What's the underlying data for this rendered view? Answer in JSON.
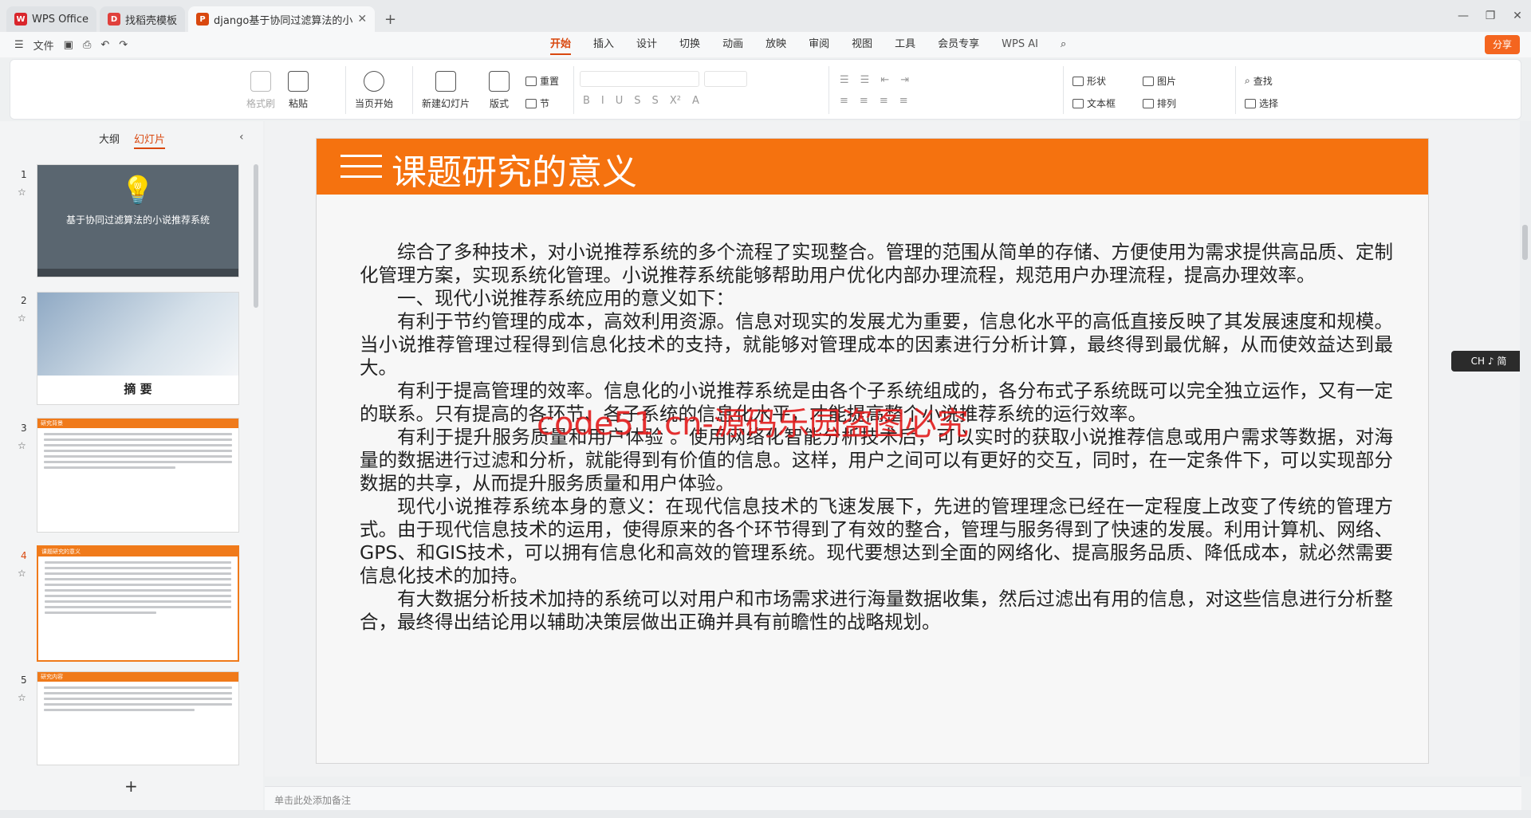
{
  "tabs": [
    {
      "label": "WPS Office",
      "icon": "wps-logo-icon",
      "color": "#d9262c"
    },
    {
      "label": "找稻壳模板",
      "icon": "docer-icon",
      "color": "#e0403c"
    },
    {
      "label": "django基于协同过滤算法的小",
      "icon": "ppt-icon",
      "color": "#d9480f"
    }
  ],
  "menu": {
    "file": "文件",
    "tabs": [
      "开始",
      "插入",
      "设计",
      "切换",
      "动画",
      "放映",
      "审阅",
      "视图",
      "工具",
      "会员专享"
    ],
    "ai": "WPS AI",
    "share": "分享"
  },
  "ribbon": {
    "format_painter": "格式刷",
    "paste": "粘贴",
    "play_current": "当页开始",
    "new_slide": "新建幻灯片",
    "layout": "版式",
    "reset": "重置",
    "section": "节",
    "shape": "形状",
    "picture": "图片",
    "textbox": "文本框",
    "arrange": "排列",
    "find": "查找",
    "select": "选择"
  },
  "panel": {
    "outline_tab": "大纲",
    "slides_tab": "幻灯片",
    "slides": [
      {
        "num": "1",
        "title": "基于协同过滤算法的小说推荐系统"
      },
      {
        "num": "2",
        "title": "摘  要"
      },
      {
        "num": "3",
        "bar": "研究背景"
      },
      {
        "num": "4",
        "bar": "课题研究的意义"
      },
      {
        "num": "5",
        "bar": "研究内容"
      }
    ],
    "add": "+"
  },
  "slide": {
    "title": "课题研究的意义",
    "paragraphs": [
      "综合了多种技术，对小说推荐系统的多个流程了实现整合。管理的范围从简单的存储、方便使用为需求提供高品质、定制化管理方案，实现系统化管理。小说推荐系统能够帮助用户优化内部办理流程，规范用户办理流程，提高办理效率。",
      "一、现代小说推荐系统应用的意义如下：",
      "有利于节约管理的成本，高效利用资源。信息对现实的发展尤为重要，信息化水平的高低直接反映了其发展速度和规模。当小说推荐管理过程得到信息化技术的支持，就能够对管理成本的因素进行分析计算，最终得到最优解，从而使效益达到最大。",
      "有利于提高管理的效率。信息化的小说推荐系统是由各个子系统组成的，各分布式子系统既可以完全独立运作，又有一定的联系。只有提高的各环节、各子系统的信息化水平，才能提高整个小说推荐系统的运行效率。",
      "有利于提升服务质量和用户体验 。使用网络化智能分析技术后，可以实时的获取小说推荐信息或用户需求等数据，对海量的数据进行过滤和分析，就能得到有价值的信息。这样，用户之间可以有更好的交互，同时，在一定条件下，可以实现部分数据的共享，从而提升服务质量和用户体验。",
      "现代小说推荐系统本身的意义：在现代信息技术的飞速发展下，先进的管理理念已经在一定程度上改变了传统的管理方式。由于现代信息技术的运用，使得原来的各个环节得到了有效的整合，管理与服务得到了快速的发展。利用计算机、网络、 GPS、和GIS技术，可以拥有信息化和高效的管理系统。现代要想达到全面的网络化、提高服务品质、降低成本，就必然需要信息化技术的加持。",
      "有大数据分析技术加持的系统可以对用户和市场需求进行海量数据收集，然后过滤出有用的信息，对这些信息进行分析整合，最终得出结论用以辅助决策层做出正确并具有前瞻性的战略规划。"
    ],
    "watermark": "code51.cn-源码乐园盗图必究"
  },
  "ime": "CH ♪ 简",
  "notes_placeholder": "单击此处添加备注",
  "colors": {
    "accent": "#f5720f",
    "brand": "#d9480f"
  }
}
